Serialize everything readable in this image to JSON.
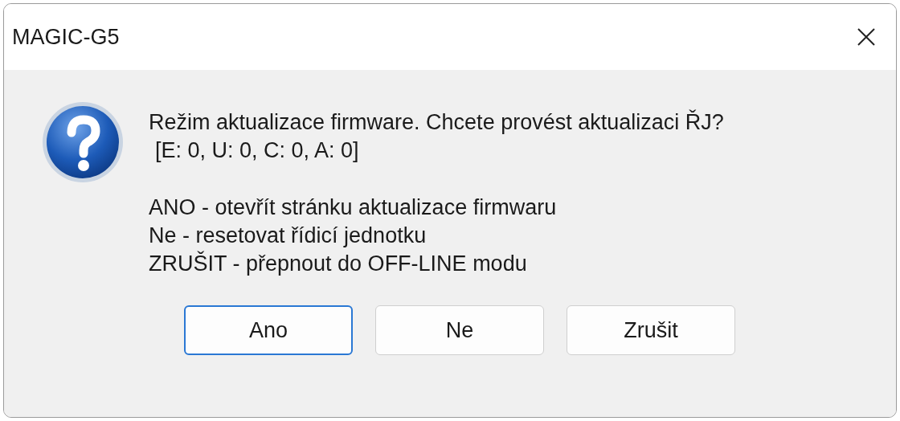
{
  "window": {
    "title": "MAGIC-G5"
  },
  "dialog": {
    "icon": {
      "kind": "question"
    },
    "message": [
      "Režim aktualizace firmware. Chcete provést aktualizaci ŘJ?",
      "[E: 0, U: 0, C: 0, A: 0]"
    ],
    "options": [
      "ANO - otevřít stránku aktualizace firmwaru",
      "Ne - resetovat řídicí jednotku",
      "ZRUŠIT - přepnout do OFF-LINE modu"
    ]
  },
  "buttons": [
    {
      "label": "Ano",
      "selected": true
    },
    {
      "label": "Ne",
      "selected": false
    },
    {
      "label": "Zrušit",
      "selected": false
    }
  ]
}
